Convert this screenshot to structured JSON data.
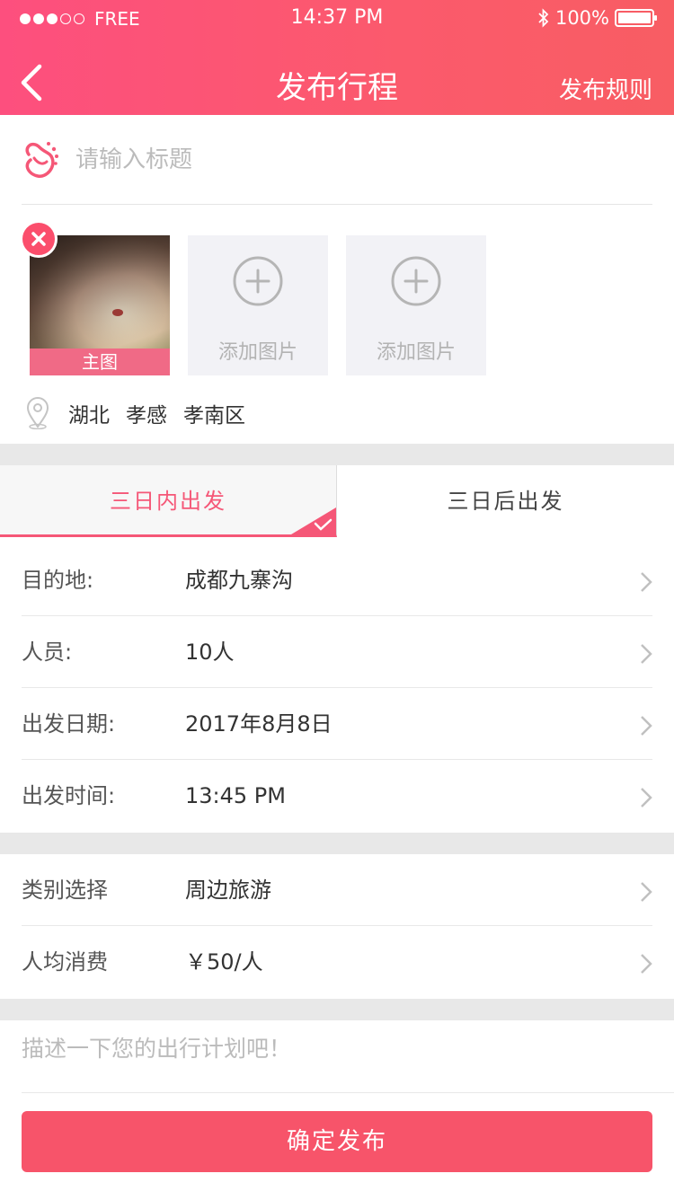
{
  "status_bar": {
    "carrier": "FREE",
    "time": "14:37 PM",
    "battery": "100%"
  },
  "nav": {
    "title": "发布行程",
    "right_action": "发布规则"
  },
  "title_input": {
    "placeholder": "请输入标题"
  },
  "photos": {
    "main_label": "主图",
    "add_label": "添加图片"
  },
  "location": {
    "province": "湖北",
    "city": "孝感",
    "district": "孝南区"
  },
  "tabs": [
    {
      "label": "三日内出发",
      "active": true
    },
    {
      "label": "三日后出发",
      "active": false
    }
  ],
  "trip_fields": [
    {
      "label": "目的地:",
      "value": "成都九寨沟"
    },
    {
      "label": "人员:",
      "value": "10人"
    },
    {
      "label": "出发日期:",
      "value": "2017年8月8日"
    },
    {
      "label": "出发时间:",
      "value": "13:45 PM"
    }
  ],
  "extra_fields": [
    {
      "label": "类别选择",
      "value": "周边旅游"
    },
    {
      "label": "人均消费",
      "value": "￥50/人"
    }
  ],
  "description": {
    "placeholder": "描述一下您的出行计划吧！"
  },
  "confirm_button": "确定发布",
  "colors": {
    "accent": "#f55777",
    "header_start": "#fd4f7e",
    "header_end": "#f85d63",
    "button": "#f7546a"
  }
}
